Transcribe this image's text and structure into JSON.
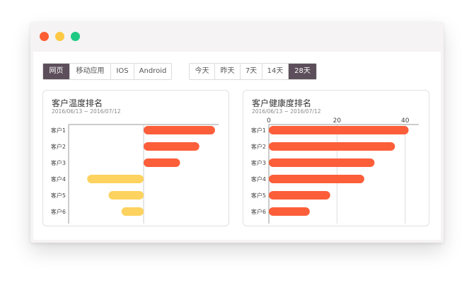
{
  "window": {
    "controls": [
      {
        "name": "close",
        "color": "#fc5d34"
      },
      {
        "name": "minimize",
        "color": "#fdc843"
      },
      {
        "name": "maximize",
        "color": "#1fc983"
      }
    ]
  },
  "platform_tabs": {
    "items": [
      "网页",
      "移动应用",
      "IOS",
      "Android"
    ],
    "selected": "网页"
  },
  "range_tabs": {
    "items": [
      "今天",
      "昨天",
      "7天",
      "14天",
      "28天"
    ],
    "selected": "28天"
  },
  "colors": {
    "hot": "#fc5e3a",
    "cold": "#fdd25e",
    "active_tab": "#5c4f5b"
  },
  "cards": {
    "temperature": {
      "title": "客户温度排名",
      "subtitle": "2016/06/13 ~ 2016/07/12"
    },
    "health": {
      "title": "客户健康度排名",
      "subtitle": "2016/06/13 ~ 2016/07/12"
    }
  },
  "chart_data": [
    {
      "type": "bar",
      "orientation": "horizontal",
      "title": "客户温度排名",
      "subtitle": "2016/06/13 ~ 2016/07/12",
      "categories": [
        "客户1",
        "客户2",
        "客户3",
        "客户4",
        "客户5",
        "客户6"
      ],
      "values": [
        100,
        78,
        51,
        -79,
        -49,
        -31
      ],
      "xlim": [
        -105,
        105
      ],
      "x_tick_labels": [],
      "grid": false
    },
    {
      "type": "bar",
      "orientation": "horizontal",
      "title": "客户健康度排名",
      "subtitle": "2016/06/13 ~ 2016/07/12",
      "categories": [
        "客户1",
        "客户2",
        "客户3",
        "客户4",
        "客户5",
        "客户6"
      ],
      "values": [
        41,
        37,
        31,
        28,
        18,
        12
      ],
      "xlim": [
        0,
        44
      ],
      "x_ticks": [
        0,
        20,
        40
      ],
      "grid": true
    }
  ]
}
